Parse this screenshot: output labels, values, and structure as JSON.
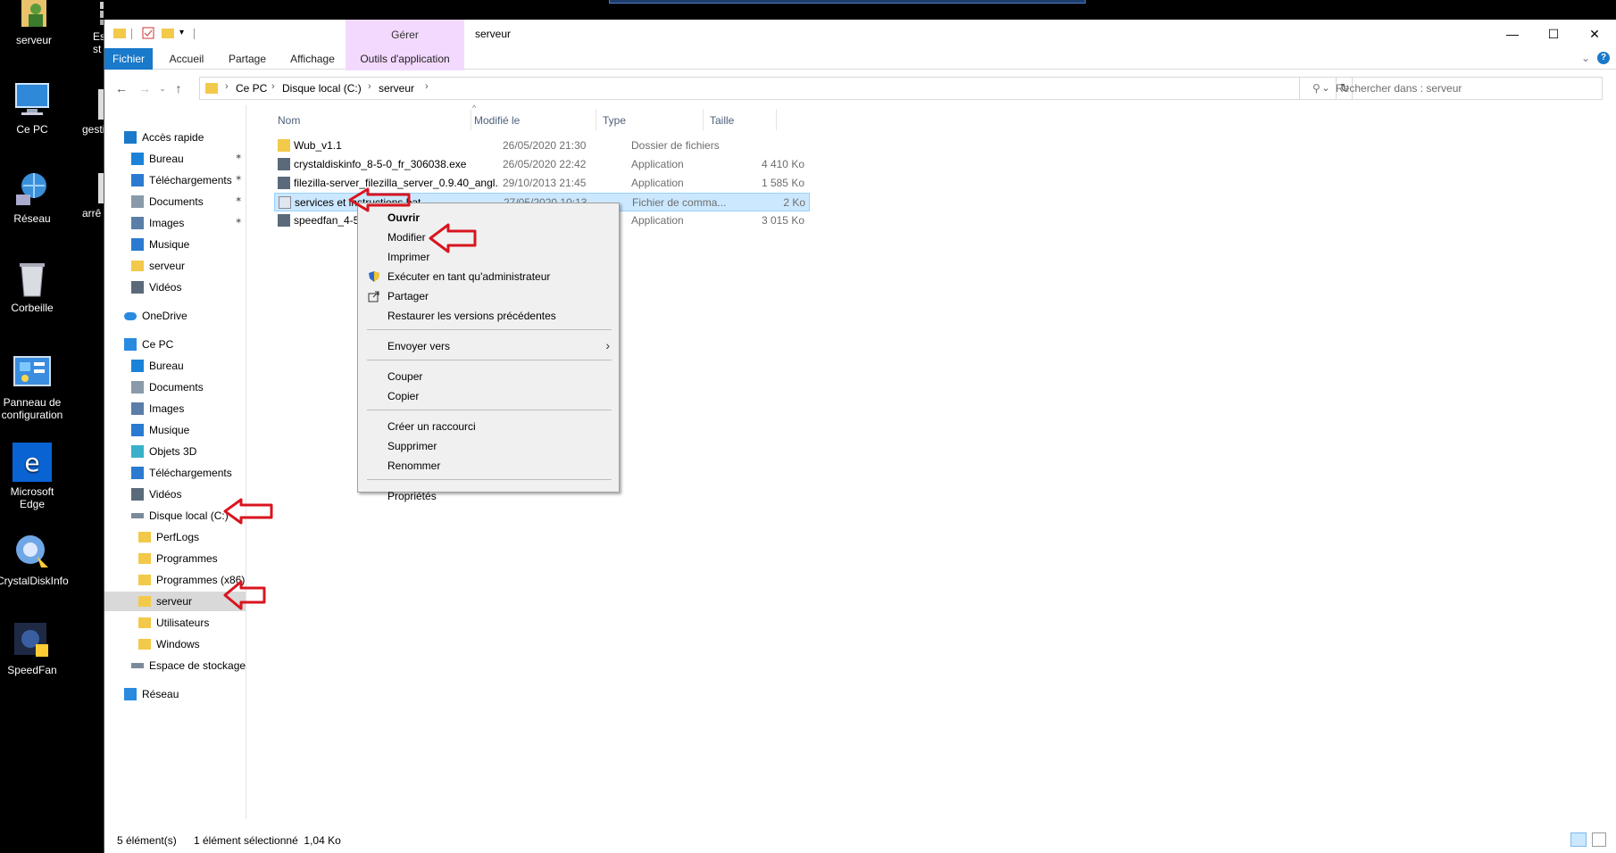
{
  "desktop": {
    "icons": [
      {
        "label": "serveur"
      },
      {
        "label": "Ce PC"
      },
      {
        "label": "Réseau"
      },
      {
        "label": "Corbeille"
      },
      {
        "label": "Panneau de configuration"
      },
      {
        "label": "Microsoft Edge"
      },
      {
        "label": "CrystalDiskInfo"
      },
      {
        "label": "SpeedFan"
      },
      {
        "label": "gesti"
      },
      {
        "label": "arrê"
      },
      {
        "label": "Es st"
      }
    ]
  },
  "window": {
    "title": "serveur",
    "manage_label": "Gérer",
    "controls": {
      "minimize": "—",
      "maximize": "☐",
      "close": "✕"
    }
  },
  "ribbon": {
    "tabs": [
      "Fichier",
      "Accueil",
      "Partage",
      "Affichage",
      "Outils d'application"
    ]
  },
  "address": {
    "crumbs": [
      "Ce PC",
      "Disque local (C:)",
      "serveur"
    ],
    "search_placeholder": "Rechercher dans : serveur"
  },
  "navpane": {
    "items": [
      {
        "label": "Accès rapide",
        "icon": "star-icon"
      },
      {
        "label": "Bureau",
        "icon": "desktop-icon",
        "pinned": true
      },
      {
        "label": "Téléchargements",
        "icon": "download-icon",
        "pinned": true
      },
      {
        "label": "Documents",
        "icon": "documents-icon",
        "pinned": true
      },
      {
        "label": "Images",
        "icon": "images-icon",
        "pinned": true
      },
      {
        "label": "Musique",
        "icon": "music-icon"
      },
      {
        "label": "serveur",
        "icon": "folder-icon"
      },
      {
        "label": "Vidéos",
        "icon": "videos-icon"
      },
      {
        "label": "OneDrive",
        "icon": "cloud-icon"
      },
      {
        "label": "Ce PC",
        "icon": "pc-icon"
      },
      {
        "label": "Bureau",
        "icon": "desktop-icon"
      },
      {
        "label": "Documents",
        "icon": "documents-icon"
      },
      {
        "label": "Images",
        "icon": "images-icon"
      },
      {
        "label": "Musique",
        "icon": "music-icon"
      },
      {
        "label": "Objets 3D",
        "icon": "cube-icon"
      },
      {
        "label": "Téléchargements",
        "icon": "download-icon"
      },
      {
        "label": "Vidéos",
        "icon": "videos-icon"
      },
      {
        "label": "Disque local (C:)",
        "icon": "drive-icon"
      },
      {
        "label": "PerfLogs",
        "icon": "folder-icon"
      },
      {
        "label": "Programmes",
        "icon": "folder-icon"
      },
      {
        "label": "Programmes (x86)",
        "icon": "folder-icon"
      },
      {
        "label": "serveur",
        "icon": "folder-icon",
        "selected": true
      },
      {
        "label": "Utilisateurs",
        "icon": "folder-icon"
      },
      {
        "label": "Windows",
        "icon": "folder-icon"
      },
      {
        "label": "Espace de stockage",
        "icon": "drive-icon"
      },
      {
        "label": "Réseau",
        "icon": "network-icon"
      }
    ]
  },
  "filelist": {
    "columns": [
      "Nom",
      "Modifié le",
      "Type",
      "Taille"
    ],
    "rows": [
      {
        "name": "Wub_v1.1",
        "date": "26/05/2020 21:30",
        "type": "Dossier de fichiers",
        "size": "",
        "icon": "folder-icon"
      },
      {
        "name": "crystaldiskinfo_8-5-0_fr_306038.exe",
        "date": "26/05/2020 22:42",
        "type": "Application",
        "size": "4 410 Ko",
        "icon": "exe-icon"
      },
      {
        "name": "filezilla-server_filezilla_server_0.9.40_angl...",
        "date": "29/10/2013 21:45",
        "type": "Application",
        "size": "1 585 Ko",
        "icon": "exe-icon"
      },
      {
        "name": "services et instructions.bat",
        "date": "27/05/2020 10:13",
        "type": "Fichier de comma...",
        "size": "2 Ko",
        "icon": "bat-icon",
        "selected": true
      },
      {
        "name": "speedfan_4-52_e...",
        "date": "",
        "type": "Application",
        "size": "3 015 Ko",
        "icon": "exe-icon"
      }
    ]
  },
  "status": {
    "count": "5 élément(s)",
    "selection": "1 élément sélectionné  1,04 Ko"
  },
  "context_menu": {
    "items": [
      {
        "label": "Ouvrir",
        "bold": true
      },
      {
        "label": "Modifier"
      },
      {
        "label": "Imprimer"
      },
      {
        "label": "Exécuter en tant qu'administrateur",
        "icon": "shield-icon"
      },
      {
        "label": "Partager",
        "icon": "share-icon"
      },
      {
        "label": "Restaurer les versions précédentes"
      },
      {
        "label": "Envoyer vers",
        "submenu": true
      },
      {
        "label": "Couper"
      },
      {
        "label": "Copier"
      },
      {
        "label": "Créer un raccourci"
      },
      {
        "label": "Supprimer"
      },
      {
        "label": "Renommer"
      },
      {
        "label": "Propriétés"
      }
    ]
  },
  "colors": {
    "accent": "#1979ca",
    "manage_tab": "#f4d9ff",
    "selection": "#cce8ff",
    "annotation_arrow": "#d9141e"
  }
}
